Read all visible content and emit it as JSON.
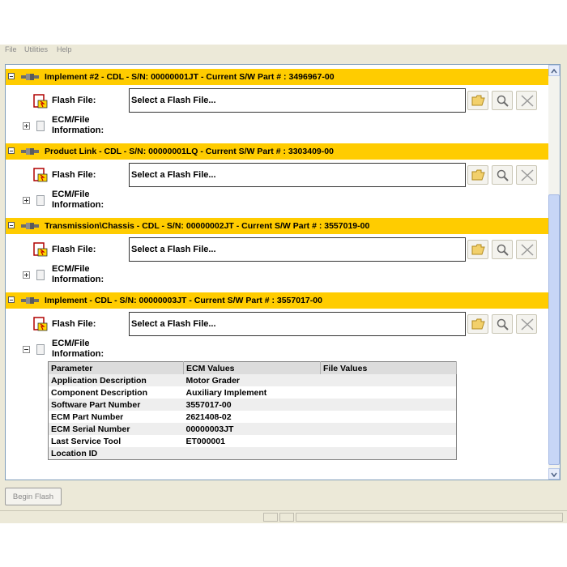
{
  "menubar": {
    "items": [
      "File",
      "Utilities",
      "Help"
    ]
  },
  "common": {
    "flash_file_label": "Flash File:",
    "flash_placeholder": "Select a Flash File...",
    "ecm_label_line1": "ECM/File",
    "ecm_label_line2": "Information:"
  },
  "sections": [
    {
      "title": "Implement #2 - CDL - S/N: 00000001JT - Current S/W Part # : 3496967-00",
      "expanded": false
    },
    {
      "title": "Product Link - CDL - S/N: 00000001LQ - Current S/W Part # : 3303409-00",
      "expanded": false
    },
    {
      "title": "Transmission\\Chassis - CDL - S/N: 00000002JT - Current S/W Part # : 3557019-00",
      "expanded": false
    },
    {
      "title": "Implement - CDL - S/N: 00000003JT - Current S/W Part # : 3557017-00",
      "expanded": true
    }
  ],
  "info_table": {
    "headers": [
      "Parameter",
      "ECM Values",
      "File Values"
    ],
    "rows": [
      [
        "Application Description",
        "Motor Grader",
        ""
      ],
      [
        "Component Description",
        "Auxiliary Implement",
        ""
      ],
      [
        "Software Part Number",
        "3557017-00",
        ""
      ],
      [
        "ECM Part Number",
        "2621408-02",
        ""
      ],
      [
        "ECM Serial Number",
        "00000003JT",
        ""
      ],
      [
        "Last Service Tool",
        "ET000001",
        ""
      ],
      [
        "Location ID",
        "",
        ""
      ]
    ]
  },
  "footer": {
    "begin_flash_label": "Begin Flash"
  },
  "colors": {
    "section_header": "#ffcc00",
    "panel_border": "#7f9db9"
  },
  "icons": {
    "folder": "folder-open-icon",
    "search": "magnifier-icon",
    "clear": "x-icon",
    "flash": "flash-file-icon",
    "plug": "connector-icon"
  }
}
